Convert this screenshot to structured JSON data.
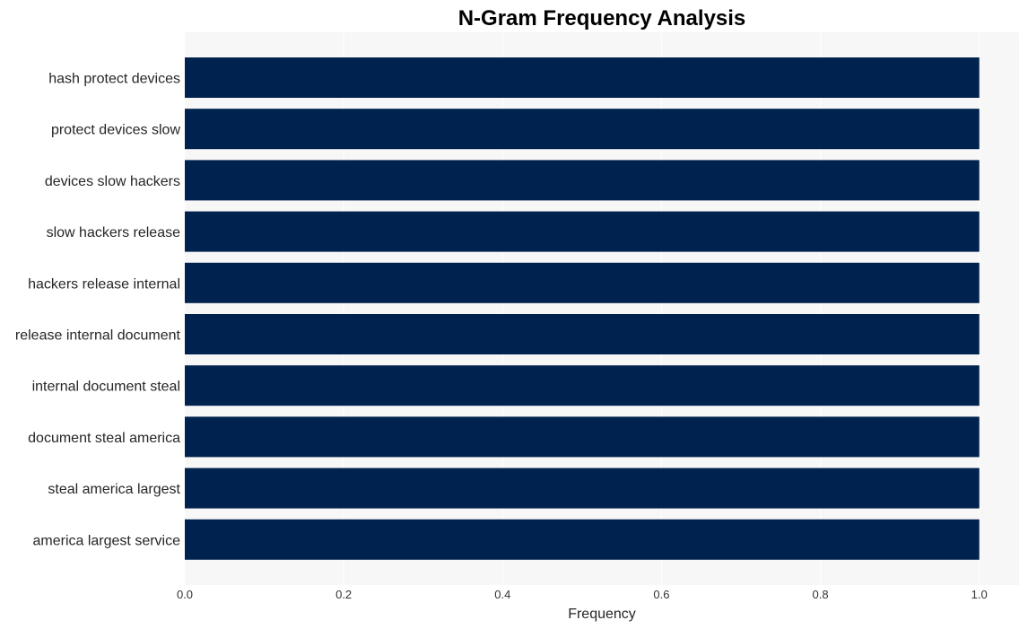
{
  "chart_data": {
    "type": "bar",
    "orientation": "horizontal",
    "title": "N-Gram Frequency Analysis",
    "xlabel": "Frequency",
    "ylabel": "",
    "categories": [
      "hash protect devices",
      "protect devices slow",
      "devices slow hackers",
      "slow hackers release",
      "hackers release internal",
      "release internal document",
      "internal document steal",
      "document steal america",
      "steal america largest",
      "america largest service"
    ],
    "values": [
      1,
      1,
      1,
      1,
      1,
      1,
      1,
      1,
      1,
      1
    ],
    "xlim": [
      0,
      1.05
    ],
    "xticks": [
      0.0,
      0.2,
      0.4,
      0.6,
      0.8,
      1.0
    ],
    "xtick_labels": [
      "0.0",
      "0.2",
      "0.4",
      "0.6",
      "0.8",
      "1.0"
    ],
    "grid": true,
    "legend": "none",
    "bar_color": "#00224e",
    "plot_background": "#f7f7f7",
    "grid_color": "#ffffff"
  }
}
